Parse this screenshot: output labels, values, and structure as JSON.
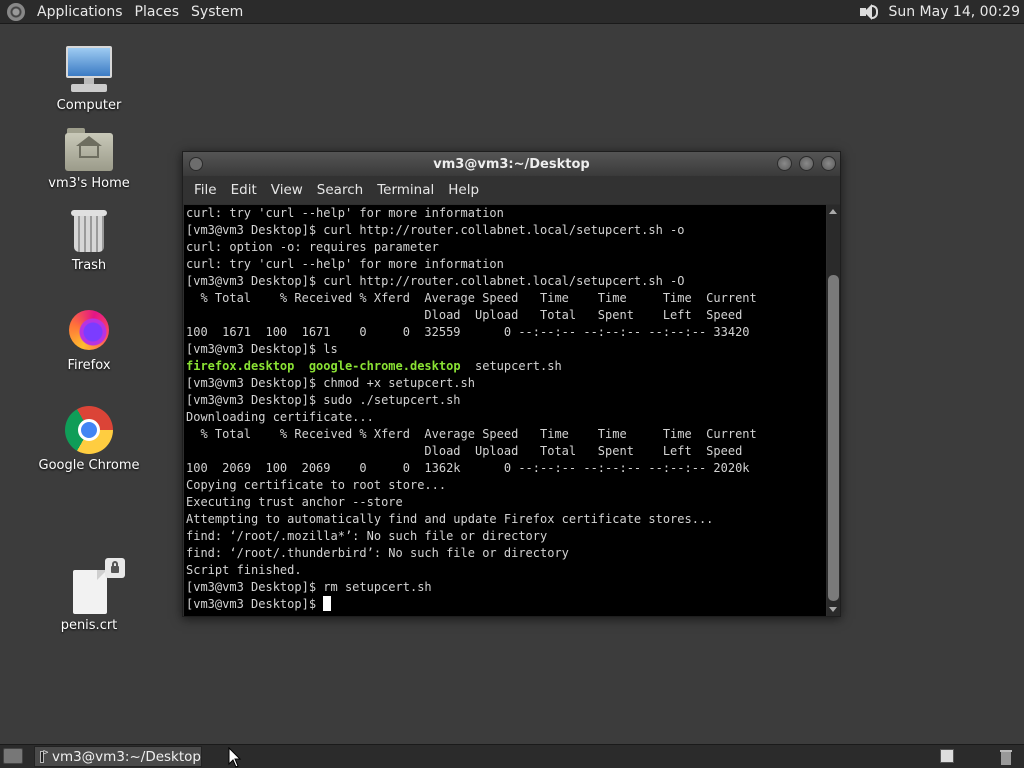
{
  "top_panel": {
    "menu": [
      "Applications",
      "Places",
      "System"
    ],
    "clock": "Sun May 14, 00:29",
    "volume_icon": "volume-icon"
  },
  "desktop_icons": [
    {
      "label": "Computer",
      "icon": "computer-icon"
    },
    {
      "label": "vm3's Home",
      "icon": "home-folder-icon"
    },
    {
      "label": "Trash",
      "icon": "trash-icon"
    },
    {
      "label": "Firefox",
      "icon": "firefox-icon"
    },
    {
      "label": "Google Chrome",
      "icon": "chrome-icon"
    },
    {
      "label": "penis.crt",
      "icon": "certificate-file-icon"
    }
  ],
  "terminal": {
    "title": "vm3@vm3:~/Desktop",
    "menu": [
      "File",
      "Edit",
      "View",
      "Search",
      "Terminal",
      "Help"
    ],
    "lines": [
      "curl: try 'curl --help' for more information",
      "[vm3@vm3 Desktop]$ curl http://router.collabnet.local/setupcert.sh -o",
      "curl: option -o: requires parameter",
      "curl: try 'curl --help' for more information",
      "[vm3@vm3 Desktop]$ curl http://router.collabnet.local/setupcert.sh -O",
      "  % Total    % Received % Xferd  Average Speed   Time    Time     Time  Current",
      "                                 Dload  Upload   Total   Spent    Left  Speed",
      "100  1671  100  1671    0     0  32559      0 --:--:-- --:--:-- --:--:-- 33420",
      "[vm3@vm3 Desktop]$ ls",
      "",
      "[vm3@vm3 Desktop]$ chmod +x setupcert.sh",
      "[vm3@vm3 Desktop]$ sudo ./setupcert.sh",
      "Downloading certificate...",
      "  % Total    % Received % Xferd  Average Speed   Time    Time     Time  Current",
      "                                 Dload  Upload   Total   Spent    Left  Speed",
      "100  2069  100  2069    0     0  1362k      0 --:--:-- --:--:-- --:--:-- 2020k",
      "Copying certificate to root store...",
      "Executing trust anchor --store",
      "Attempting to automatically find and update Firefox certificate stores...",
      "find: ‘/root/.mozilla*’: No such file or directory",
      "find: ‘/root/.thunderbird’: No such file or directory",
      "Script finished.",
      "[vm3@vm3 Desktop]$ rm setupcert.sh",
      "[vm3@vm3 Desktop]$ "
    ],
    "ls_output": {
      "file1": "firefox.desktop",
      "file2": "google-chrome.desktop",
      "file3": "setupcert.sh"
    }
  },
  "taskbar": {
    "task_label": "vm3@vm3:~/Desktop"
  },
  "colors": {
    "desktop_bg": "#3c3c3c",
    "terminal_bg": "#000000",
    "terminal_fg": "#d3d3d3",
    "ls_executable": "#8ae234"
  }
}
